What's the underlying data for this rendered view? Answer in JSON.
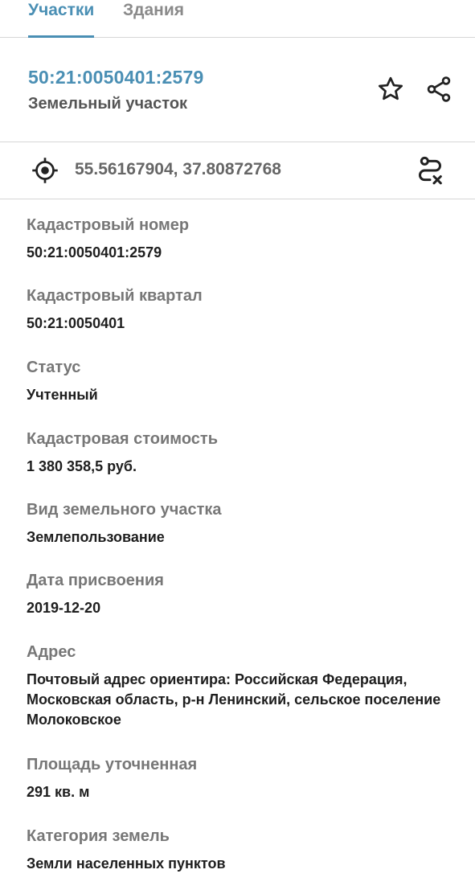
{
  "tabs": [
    {
      "label": "Участки",
      "active": true
    },
    {
      "label": "Здания",
      "active": false
    }
  ],
  "header": {
    "cadastral_number": "50:21:0050401:2579",
    "object_type": "Земельный участок",
    "favorite_icon": "star-icon",
    "share_icon": "share-icon"
  },
  "coordinates": {
    "text": "55.56167904, 37.80872768",
    "locate_icon": "target-icon",
    "route_icon": "route-icon"
  },
  "fields": [
    {
      "label": "Кадастровый номер",
      "value": "50:21:0050401:2579"
    },
    {
      "label": "Кадастровый квартал",
      "value": "50:21:0050401"
    },
    {
      "label": "Статус",
      "value": "Учтенный"
    },
    {
      "label": "Кадастровая стоимость",
      "value": "1 380 358,5 руб."
    },
    {
      "label": "Вид земельного участка",
      "value": "Землепользование"
    },
    {
      "label": "Дата присвоения",
      "value": "2019-12-20"
    },
    {
      "label": "Адрес",
      "value": "Почтовый адрес ориентира: Российская Федерация, Московская область, р-н Ленинский, сельское поселение Молоковское"
    },
    {
      "label": "Площадь уточненная",
      "value": "291 кв. м"
    },
    {
      "label": "Категория земель",
      "value": "Земли населенных пунктов"
    }
  ],
  "colors": {
    "accent": "#4a8fb4",
    "label": "#777777",
    "value": "#1e1e1e",
    "divider": "#d6d6d6"
  }
}
